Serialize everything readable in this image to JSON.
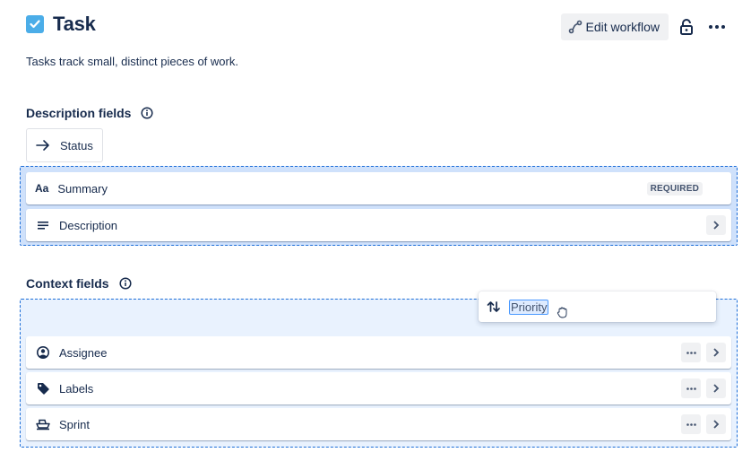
{
  "header": {
    "title": "Task",
    "type_icon": "checkbox-checked-icon",
    "type_color": "#4bade8",
    "subtitle": "Tasks track small, distinct pieces of work."
  },
  "actions": {
    "edit_workflow_label": "Edit workflow",
    "edit_workflow_icon": "workflow-icon",
    "lock_icon": "unlock-icon",
    "more_icon": "more-icon"
  },
  "description_section": {
    "title": "Description fields",
    "info_icon": "info-icon",
    "status_chip": {
      "label": "Status",
      "icon": "arrow-right-icon"
    },
    "fields": [
      {
        "label": "Summary",
        "icon": "text-icon",
        "badge": "REQUIRED"
      },
      {
        "label": "Description",
        "icon": "paragraph-icon",
        "chevron": true
      }
    ]
  },
  "context_section": {
    "title": "Context fields",
    "info_icon": "info-icon",
    "dragging_item": {
      "label": "Priority",
      "icon": "priority-icon"
    },
    "fields": [
      {
        "label": "Assignee",
        "icon": "person-icon"
      },
      {
        "label": "Labels",
        "icon": "tag-icon"
      },
      {
        "label": "Sprint",
        "icon": "sprint-icon"
      }
    ]
  },
  "colors": {
    "accent": "#1d6ed8",
    "dropzone_active": "#cfe1fb",
    "dropzone_light": "#e9f2fe",
    "text": "#172b4d"
  }
}
